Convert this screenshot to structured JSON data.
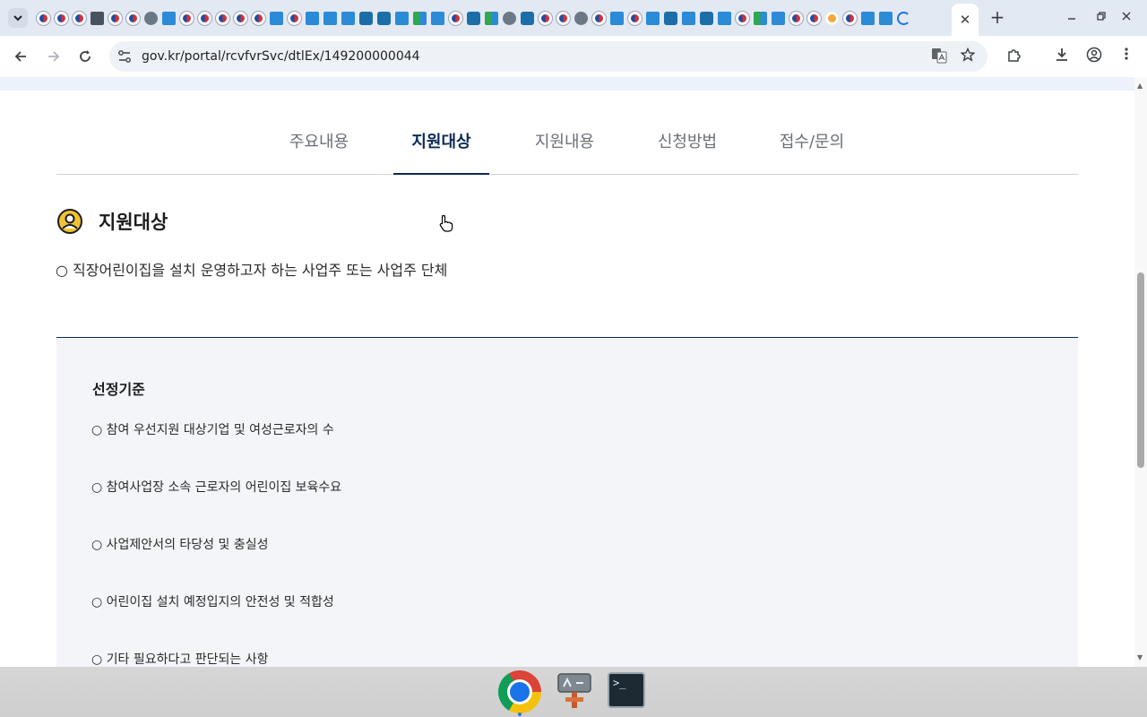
{
  "browser": {
    "url": "gov.kr/portal/rcvfvrSvc/dtlEx/149200000044",
    "active_tab_close": "✕",
    "new_tab": "+",
    "favicon_tabs": [
      "flag",
      "flag",
      "flag",
      "dark",
      "flag",
      "flag",
      "globe",
      "blue",
      "flag",
      "flag",
      "flag",
      "flag",
      "flag",
      "blue",
      "flag",
      "blue",
      "blue",
      "blue",
      "teal",
      "teal",
      "blue",
      "green",
      "blue",
      "flag",
      "teal",
      "green",
      "globe",
      "teal",
      "flag",
      "flag",
      "globe",
      "flag",
      "blue",
      "flag",
      "blue",
      "teal",
      "blue",
      "teal",
      "blue",
      "flag",
      "green",
      "blue",
      "flag",
      "flag",
      "orange",
      "flag",
      "blue",
      "blue",
      "load"
    ]
  },
  "page": {
    "tabs": [
      {
        "label": "주요내용",
        "active": false
      },
      {
        "label": "지원대상",
        "active": true
      },
      {
        "label": "지원내용",
        "active": false
      },
      {
        "label": "신청방법",
        "active": false
      },
      {
        "label": "접수/문의",
        "active": false
      }
    ],
    "section_title": "지원대상",
    "target_text": "○ 직장어린이집을 설치 운영하고자 하는 사업주 또는 사업주 단체",
    "criteria": {
      "title": "선정기준",
      "items": [
        "○ 참여 우선지원 대상기업 및 여성근로자의 수",
        "○ 참여사업장 소속 근로자의 어린이집 보육수요",
        "○ 사업제안서의 타당성 및 충실성",
        "○ 어린이집 설치 예정입지의 안전성 및 적합성",
        "○ 기타 필요하다고 판단되는 사항"
      ]
    }
  },
  "colors": {
    "accent_navy": "#0b2a57",
    "icon_yellow": "#f2c230",
    "criteria_bg": "#f3f5f9"
  },
  "dock": {
    "apps": [
      "chrome-icon",
      "tools-icon",
      "terminal-icon"
    ],
    "terminal_prompt": ">_"
  }
}
